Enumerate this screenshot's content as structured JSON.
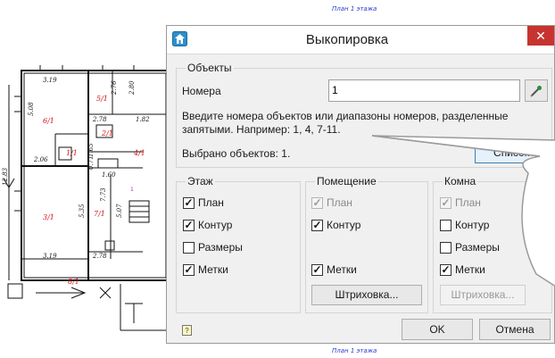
{
  "cad": {
    "top_label": "План 1 этажа",
    "bottom_label": "План 1 этажа",
    "left_dim": "12.83",
    "dims": [
      "3.19",
      "2.76",
      "2.80",
      "5.08",
      "2.78",
      "1.82",
      "2.06",
      "1.60",
      "3.19",
      "2.78",
      "5.35",
      "7.73",
      "5.07",
      "1.65",
      "8.71",
      "0.71"
    ]
  },
  "dialog": {
    "title": "Выкопировка",
    "close_symbol": "✕",
    "objects": {
      "label": "Объекты",
      "numbers_label": "Номера",
      "numbers_value": "1",
      "hint": "Введите номера объектов или диапазоны номеров, разделенные запятыми. Например: 1, 4, 7-11.",
      "selected": "Выбрано объектов: 1.",
      "list_button": "Список"
    },
    "floor": {
      "label": "Этаж",
      "plan": "План",
      "contour": "Контур",
      "sizes": "Размеры",
      "marks": "Метки"
    },
    "room": {
      "label": "Помещение",
      "plan": "План",
      "contour": "Контур",
      "marks": "Метки",
      "hatch_button": "Штриховка..."
    },
    "chamber": {
      "label": "Комна",
      "plan": "План",
      "contour": "Контур",
      "sizes": "Размеры",
      "marks": "Метки",
      "hatch_button": "Штриховка..."
    },
    "ok_button": "OK",
    "cancel_button": "Отмена",
    "help_symbol": "?"
  },
  "colors": {
    "close_red": "#c7342f",
    "cad_blue": "#2a3fd0",
    "cad_red": "#d01414",
    "cad_magenta": "#c020c0"
  }
}
